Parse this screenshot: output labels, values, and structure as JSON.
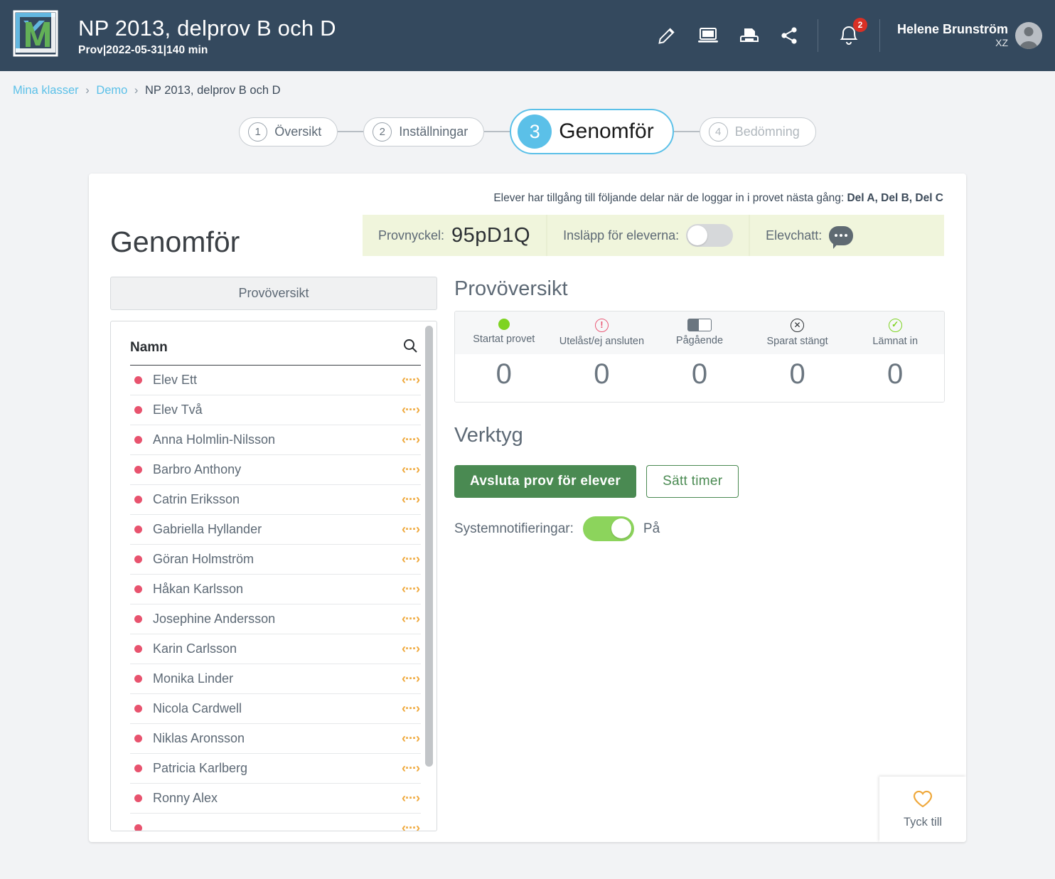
{
  "header": {
    "logo_alt": "km-logo",
    "title": "NP 2013, delprov B och D",
    "subtitle": "Prov|2022-05-31|140 min",
    "icons": [
      "pencil-icon",
      "laptop-icon",
      "printer-icon",
      "share-icon"
    ],
    "notification_count": "2",
    "user_name": "Helene Brunström",
    "user_sub": "XZ"
  },
  "breadcrumb": {
    "items": [
      {
        "label": "Mina klasser",
        "link": true
      },
      {
        "label": "Demo",
        "link": true
      },
      {
        "label": "NP 2013, delprov B och D",
        "link": false
      }
    ],
    "separator": "›"
  },
  "stepper": {
    "steps": [
      {
        "num": "1",
        "label": "Översikt",
        "state": "normal"
      },
      {
        "num": "2",
        "label": "Inställningar",
        "state": "normal"
      },
      {
        "num": "3",
        "label": "Genomför",
        "state": "active"
      },
      {
        "num": "4",
        "label": "Bedömning",
        "state": "dim"
      }
    ]
  },
  "card": {
    "notice_text": "Elever har tillgång till följande delar när de loggar in i provet nästa gång: ",
    "notice_bold": "Del A, Del B, Del C",
    "page_title": "Genomför",
    "keybar": {
      "key_label": "Provnyckel:",
      "key_value": "95pD1Q",
      "access_label": "Insläpp för eleverna:",
      "access_on": false,
      "chat_label": "Elevchatt:"
    }
  },
  "left": {
    "tab_label": "Provöversikt",
    "column_header": "Namn",
    "search_icon": "search-icon",
    "students": [
      {
        "name": "Elev Ett",
        "status": "red"
      },
      {
        "name": "Elev Två",
        "status": "red"
      },
      {
        "name": "Anna Holmlin-Nilsson",
        "status": "red"
      },
      {
        "name": "Barbro Anthony",
        "status": "red"
      },
      {
        "name": "Catrin Eriksson",
        "status": "red"
      },
      {
        "name": "Gabriella Hyllander",
        "status": "red"
      },
      {
        "name": "Göran Holmström",
        "status": "red"
      },
      {
        "name": "Håkan Karlsson",
        "status": "red"
      },
      {
        "name": "Josephine Andersson",
        "status": "red"
      },
      {
        "name": "Karin Carlsson",
        "status": "red"
      },
      {
        "name": "Monika Linder",
        "status": "red"
      },
      {
        "name": "Nicola Cardwell",
        "status": "red"
      },
      {
        "name": "Niklas Aronsson",
        "status": "red"
      },
      {
        "name": "Patricia Karlberg",
        "status": "red"
      },
      {
        "name": "Ronny Alex",
        "status": "red"
      },
      {
        "name": "",
        "status": "red"
      }
    ],
    "row_action_glyph": "‹···›"
  },
  "right": {
    "overview_title": "Provöversikt",
    "stats": [
      {
        "label": "Startat provet",
        "icon": "green-dot-icon",
        "value": "0"
      },
      {
        "label": "Utelåst/ej ansluten",
        "icon": "warning-circle-icon",
        "value": "0"
      },
      {
        "label": "Pågående",
        "icon": "toggle-icon",
        "value": "0"
      },
      {
        "label": "Sparat stängt",
        "icon": "x-circle-icon",
        "value": "0"
      },
      {
        "label": "Lämnat in",
        "icon": "check-circle-icon",
        "value": "0"
      }
    ],
    "tools_title": "Verktyg",
    "btn_end_test": "Avsluta prov för elever",
    "btn_set_timer": "Sätt timer",
    "notif_label": "Systemnotifieringar:",
    "notif_value": "På",
    "notif_on": true
  },
  "feedback": {
    "icon": "heart-icon",
    "label": "Tyck till"
  },
  "colors": {
    "header_bg": "#34495e",
    "accent_blue": "#5bc0e8",
    "green_btn": "#4a8a52",
    "toggle_green": "#8cd45c",
    "status_red": "#e8536e",
    "orange": "#efa83b",
    "keybar_bg": "#f0f5dc",
    "badge_red": "#d93025"
  }
}
